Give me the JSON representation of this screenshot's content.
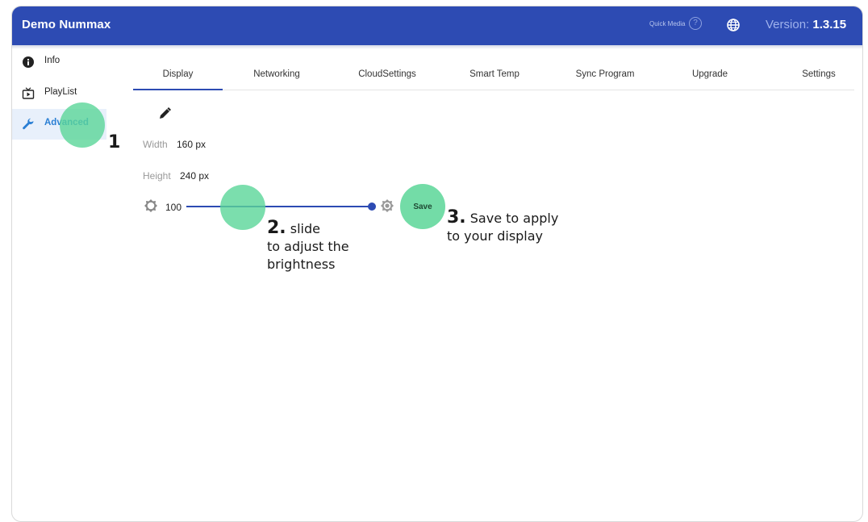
{
  "app": {
    "title": "Demo Nummax",
    "quick_media": "Quick Media",
    "version_label": "Version:",
    "version_value": "1.3.15",
    "accent_color": "#2d4bb3",
    "highlight_color": "#5ad698"
  },
  "sidebar": {
    "items": [
      {
        "label": "Info",
        "icon": "info-icon"
      },
      {
        "label": "PlayList",
        "icon": "tv-play-icon"
      },
      {
        "label": "Advanced",
        "icon": "wrench-icon",
        "active": true
      }
    ]
  },
  "tabs": [
    {
      "label": "Display",
      "active": true
    },
    {
      "label": "Networking"
    },
    {
      "label": "CloudSettings"
    },
    {
      "label": "Smart Temp"
    },
    {
      "label": "Sync Program"
    },
    {
      "label": "Upgrade"
    },
    {
      "label": "Settings"
    }
  ],
  "display": {
    "width_label": "Width",
    "width_value": "160 px",
    "height_label": "Height",
    "height_value": "240 px",
    "brightness_value": "100",
    "brightness_level": 1.0,
    "save_label": "Save"
  },
  "annotations": {
    "step1_number": "1",
    "step2_number": "2.",
    "step2_line1": "slide",
    "step2_line2": "to adjust the",
    "step2_line3": "brightness",
    "step3_number": "3.",
    "step3_line1": "Save to apply",
    "step3_line2": "to your display"
  }
}
